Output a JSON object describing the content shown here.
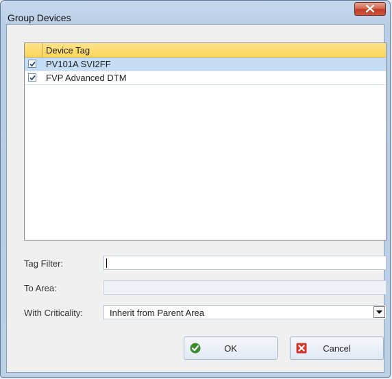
{
  "window": {
    "title": "Group Devices",
    "close_glyph": "✕"
  },
  "grid": {
    "header": "Device Tag",
    "rows": [
      {
        "label": "PV101A SVI2FF",
        "checked": true,
        "selected": true
      },
      {
        "label": "FVP Advanced DTM",
        "checked": true,
        "selected": false
      }
    ]
  },
  "form": {
    "tag_filter": {
      "label": "Tag Filter:",
      "value": ""
    },
    "to_area": {
      "label": "To Area:",
      "value": ""
    },
    "criticality": {
      "label": "With Criticality:",
      "value": "Inherit from Parent Area"
    }
  },
  "buttons": {
    "ok": "OK",
    "cancel": "Cancel"
  },
  "colors": {
    "ok_icon": "#3a8a2e",
    "cancel_icon": "#d0392b",
    "header_bg": "#f9d45a",
    "selected_row": "#c4dcf4"
  },
  "icons": {
    "ok": "check-circle-icon",
    "cancel": "x-square-icon",
    "dropdown": "chevron-down-icon"
  }
}
